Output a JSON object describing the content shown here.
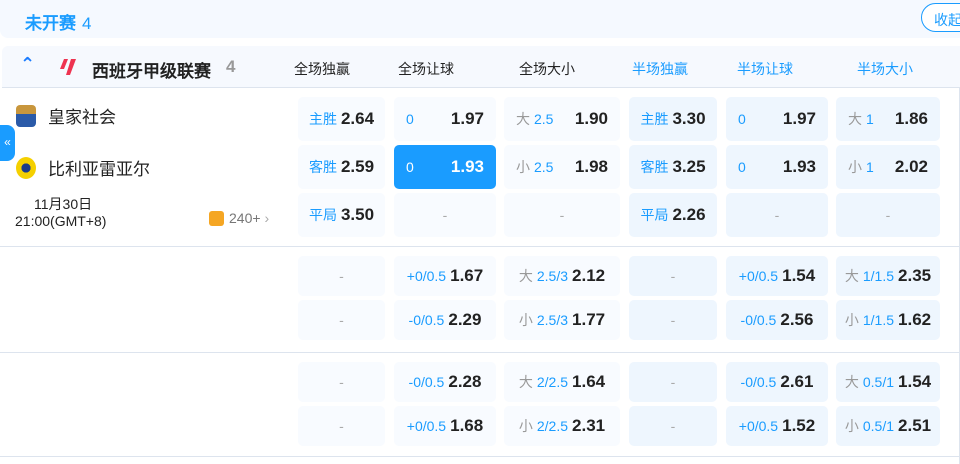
{
  "section": {
    "title": "未开赛",
    "count": "4",
    "collapse_label": "收起"
  },
  "league": {
    "name": "西班牙甲级联赛",
    "count": "4",
    "columns": [
      "全场独赢",
      "全场让球",
      "全场大小",
      "半场独赢",
      "半场让球",
      "半场大小"
    ]
  },
  "match": {
    "home": "皇家社会",
    "away": "比利亚雷亚尔",
    "date": "11月30日",
    "time": "21:00(GMT+8)",
    "more_count": "240+"
  },
  "colors": {
    "accent": "#1a9cff",
    "selected": "#1a9cff"
  },
  "rows": [
    [
      {
        "pre": "",
        "line": "主胜",
        "odds": "2.64"
      },
      {
        "line": "0",
        "odds": "1.97"
      },
      {
        "pre": "大",
        "line": "2.5",
        "odds": "1.90"
      },
      {
        "line": "主胜",
        "odds": "3.30"
      },
      {
        "line": "0",
        "odds": "1.97"
      },
      {
        "pre": "大",
        "line": "1",
        "odds": "1.86"
      }
    ],
    [
      {
        "line": "客胜",
        "odds": "2.59"
      },
      {
        "line": "0",
        "odds": "1.93",
        "selected": true
      },
      {
        "pre": "小",
        "line": "2.5",
        "odds": "1.98"
      },
      {
        "line": "客胜",
        "odds": "3.25"
      },
      {
        "line": "0",
        "odds": "1.93"
      },
      {
        "pre": "小",
        "line": "1",
        "odds": "2.02"
      }
    ],
    [
      {
        "line": "平局",
        "odds": "3.50"
      },
      {
        "odds": "-"
      },
      {
        "odds": "-"
      },
      {
        "line": "平局",
        "odds": "2.26"
      },
      {
        "odds": "-"
      },
      {
        "odds": "-"
      }
    ],
    [
      {
        "odds": "-"
      },
      {
        "line": "+0/0.5",
        "odds": "1.67"
      },
      {
        "pre": "大",
        "line": "2.5/3",
        "odds": "2.12"
      },
      {
        "odds": "-"
      },
      {
        "line": "+0/0.5",
        "odds": "1.54"
      },
      {
        "pre": "大",
        "line": "1/1.5",
        "odds": "2.35"
      }
    ],
    [
      {
        "odds": "-"
      },
      {
        "line": "-0/0.5",
        "odds": "2.29"
      },
      {
        "pre": "小",
        "line": "2.5/3",
        "odds": "1.77"
      },
      {
        "odds": "-"
      },
      {
        "line": "-0/0.5",
        "odds": "2.56"
      },
      {
        "pre": "小",
        "line": "1/1.5",
        "odds": "1.62"
      }
    ],
    [
      {
        "odds": "-"
      },
      {
        "line": "-0/0.5",
        "odds": "2.28"
      },
      {
        "pre": "大",
        "line": "2/2.5",
        "odds": "1.64"
      },
      {
        "odds": "-"
      },
      {
        "line": "-0/0.5",
        "odds": "2.61"
      },
      {
        "pre": "大",
        "line": "0.5/1",
        "odds": "1.54"
      }
    ],
    [
      {
        "odds": "-"
      },
      {
        "line": "+0/0.5",
        "odds": "1.68"
      },
      {
        "pre": "小",
        "line": "2/2.5",
        "odds": "2.31"
      },
      {
        "odds": "-"
      },
      {
        "line": "+0/0.5",
        "odds": "1.52"
      },
      {
        "pre": "小",
        "line": "0.5/1",
        "odds": "2.51"
      }
    ]
  ]
}
